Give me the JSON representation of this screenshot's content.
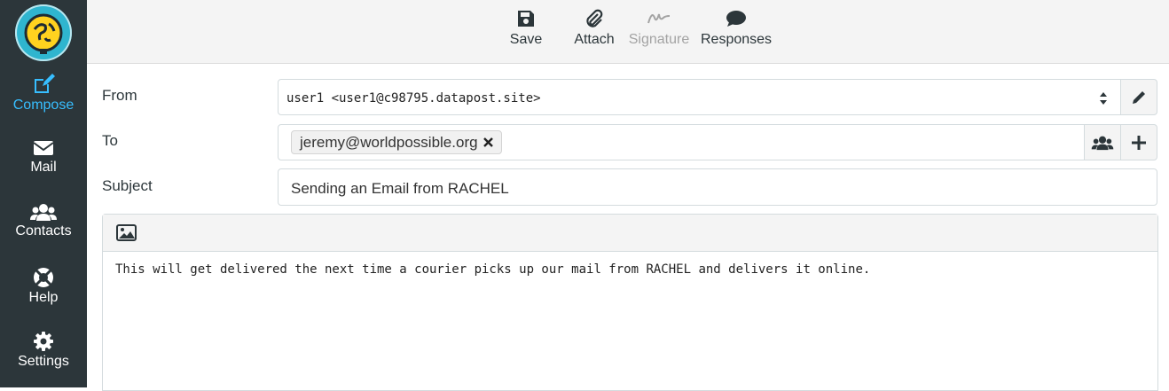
{
  "sidebar": {
    "items": [
      {
        "label": "Compose",
        "icon": "compose-icon",
        "active": true
      },
      {
        "label": "Mail",
        "icon": "envelope-icon"
      },
      {
        "label": "Contacts",
        "icon": "users-icon"
      },
      {
        "label": "Help",
        "icon": "life-ring-icon"
      },
      {
        "label": "Settings",
        "icon": "gear-icon"
      }
    ]
  },
  "toolbar": {
    "save": "Save",
    "attach": "Attach",
    "signature": "Signature",
    "responses": "Responses"
  },
  "form": {
    "from_label": "From",
    "from_value": "user1 <user1@c98795.datapost.site>",
    "to_label": "To",
    "to_recipient": "jeremy@worldpossible.org",
    "subject_label": "Subject",
    "subject_value": "Sending an Email from RACHEL",
    "body": "This will get delivered the next time a courier picks up our mail from RACHEL and delivers it online."
  },
  "colors": {
    "sidebar_bg": "#2c363a",
    "accent": "#37beff",
    "disabled": "#a3a3a3"
  }
}
